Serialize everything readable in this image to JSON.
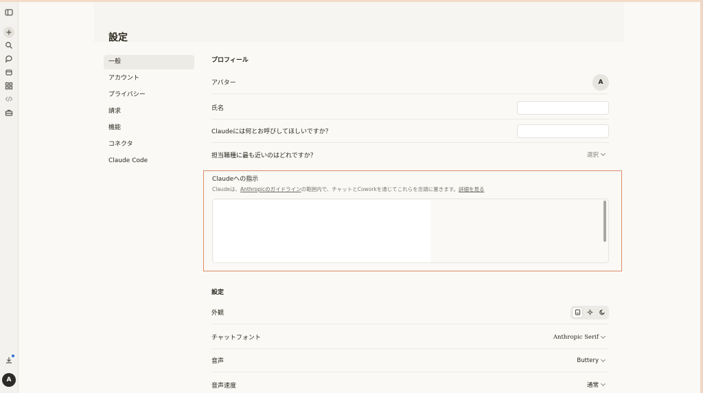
{
  "page": {
    "title": "設定"
  },
  "nav": {
    "items": [
      {
        "label": "一般",
        "active": true
      },
      {
        "label": "アカウント"
      },
      {
        "label": "プライバシー"
      },
      {
        "label": "請求"
      },
      {
        "label": "機能"
      },
      {
        "label": "コネクタ"
      },
      {
        "label": "Claude Code"
      }
    ]
  },
  "rail": {
    "icons": [
      "sidebar-toggle-icon",
      "new-chat-icon",
      "search-icon",
      "chats-icon",
      "projects-icon",
      "artifacts-icon",
      "code-icon",
      "briefcase-icon",
      "download-icon"
    ],
    "avatar_initial": "A"
  },
  "profile": {
    "section_title": "プロフィール",
    "avatar_label": "アバター",
    "avatar_initial": "A",
    "name_label": "氏名",
    "name_value": "",
    "nickname_label": "Claudeには何とお呼びしてほしいですか？",
    "nickname_value": "",
    "role_label": "担当職種に最も近いのはどれですか？",
    "role_select": "選択"
  },
  "instructions": {
    "title": "Claudeへの指示",
    "desc_prefix": "Claudeは、",
    "desc_link1": "Anthropicのガイドライン",
    "desc_middle": "の範囲内で、チャットとCoworkを通じてこれらを念頭に置きます。",
    "desc_link2": "詳細を見る",
    "value": ""
  },
  "settings": {
    "section_title": "設定",
    "appearance_label": "外観",
    "appearance_selected": "system",
    "chat_font_label": "チャットフォント",
    "chat_font_value": "Anthropic Serif",
    "voice_label": "音声",
    "voice_value": "Buttery",
    "voice_speed_label": "音声速度",
    "voice_speed_value": "通常"
  }
}
